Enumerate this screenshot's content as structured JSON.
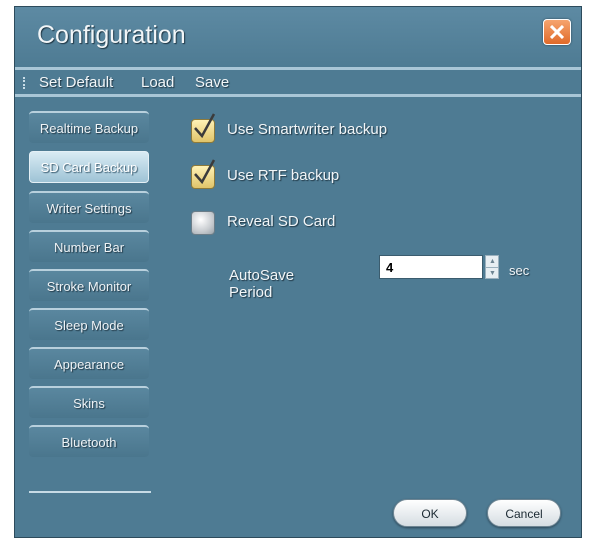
{
  "window": {
    "title": "Configuration"
  },
  "menu": {
    "set_default": "Set Default",
    "load": "Load",
    "save": "Save"
  },
  "sidebar": {
    "items": [
      {
        "label": "Realtime Backup"
      },
      {
        "label": "SD Card Backup"
      },
      {
        "label": "Writer Settings"
      },
      {
        "label": "Number Bar"
      },
      {
        "label": "Stroke Monitor"
      },
      {
        "label": "Sleep Mode"
      },
      {
        "label": "Appearance"
      },
      {
        "label": "Skins"
      },
      {
        "label": "Bluetooth"
      }
    ],
    "selected": "SD Card Backup"
  },
  "options": {
    "use_smartwriter_backup": {
      "label": "Use Smartwriter backup",
      "checked": true
    },
    "use_rtf_backup": {
      "label": "Use RTF backup",
      "checked": true
    },
    "reveal_sd_card": {
      "label": "Reveal SD Card",
      "checked": false
    }
  },
  "autosave": {
    "label": "AutoSave Period",
    "value": "4",
    "unit": "sec"
  },
  "buttons": {
    "ok": "OK",
    "cancel": "Cancel"
  },
  "colors": {
    "window_bg": "#4e7b93",
    "close_button": "#e06a2a",
    "checkbox_checked": "#e0c46a"
  }
}
